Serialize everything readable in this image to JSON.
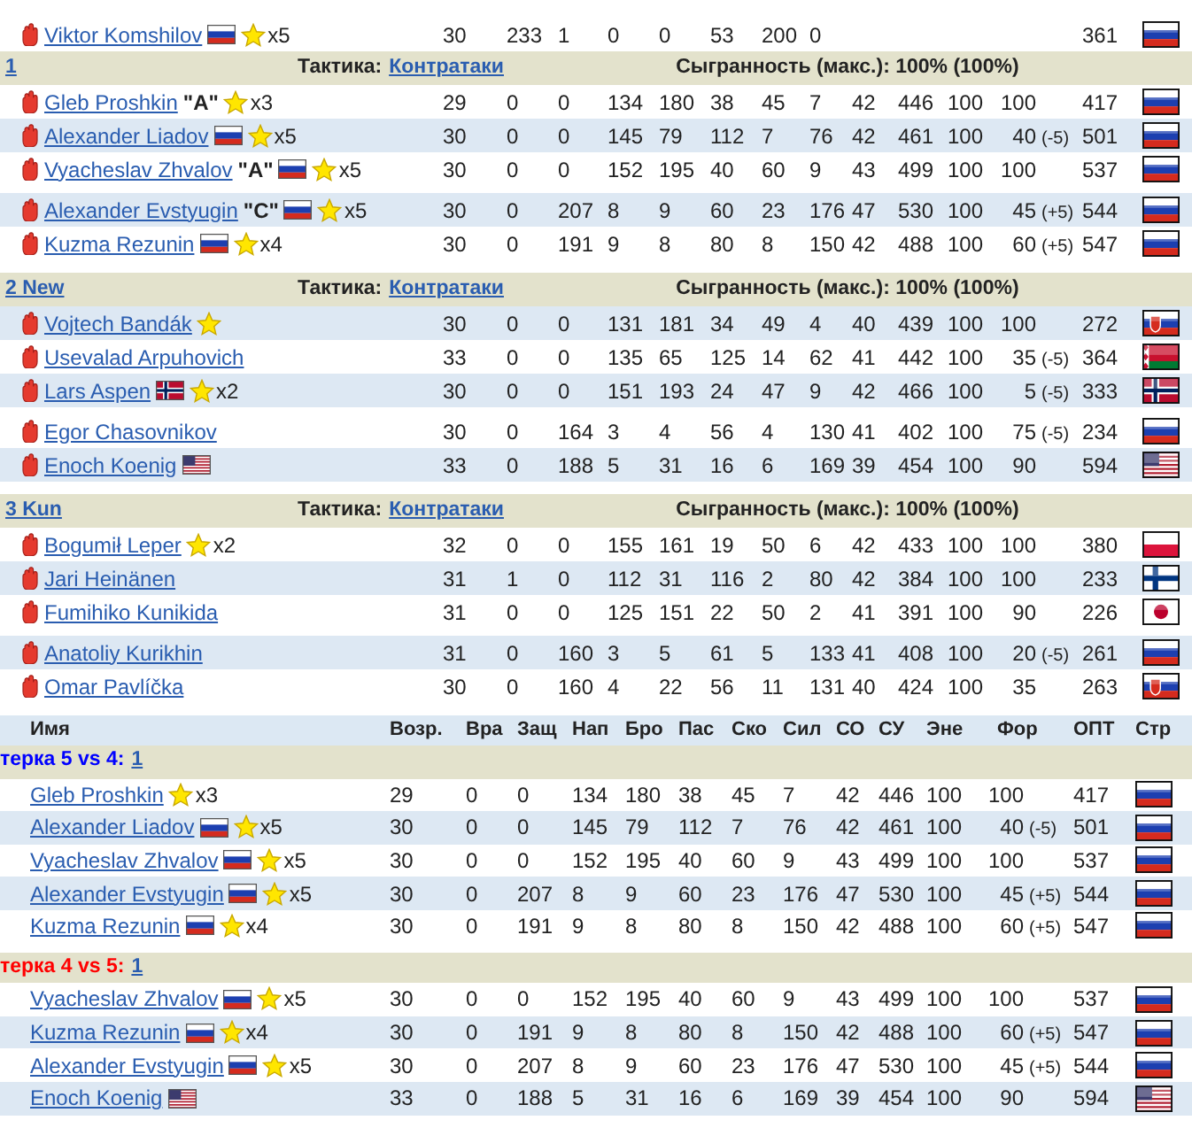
{
  "top_row": {
    "name": "Viktor Komshilov",
    "shaded": false,
    "name_flag": {
      "kind": "russia"
    },
    "star": true,
    "star_count": "x5",
    "stats": [
      "30",
      "233",
      "1",
      "0",
      "0",
      "53",
      "200",
      "0"
    ],
    "opt": "361",
    "flag": {
      "kind": "russia"
    }
  },
  "lines": [
    {
      "label": "1",
      "tactic_label": "Тактика:",
      "tactic": "Контратаки",
      "cohesion": "Сыгранность (макс.): 100% (100%)",
      "players": [
        {
          "name": "Gleb Proshkin",
          "shaded": false,
          "captain": "\"A\"",
          "star": true,
          "star_count": "x3",
          "stats": [
            "29",
            "0",
            "0",
            "134",
            "180",
            "38",
            "45",
            "7",
            "42",
            "446",
            "100"
          ],
          "form": "100",
          "opt": "417",
          "flag": {
            "kind": "russia"
          }
        },
        {
          "name": "Alexander Liadov",
          "shaded": true,
          "name_flag": {
            "kind": "russia"
          },
          "star": true,
          "star_count": "x5",
          "stats": [
            "30",
            "0",
            "0",
            "145",
            "79",
            "112",
            "7",
            "76",
            "42",
            "461",
            "100"
          ],
          "form": "40",
          "form_mod": "(-5)",
          "opt": "501",
          "flag": {
            "kind": "russia"
          }
        },
        {
          "name": "Vyacheslav Zhvalov",
          "shaded": false,
          "captain": "\"A\"",
          "name_flag": {
            "kind": "russia"
          },
          "star": true,
          "star_count": "x5",
          "stats": [
            "30",
            "0",
            "0",
            "152",
            "195",
            "40",
            "60",
            "9",
            "43",
            "499",
            "100"
          ],
          "form": "100",
          "opt": "537",
          "flag": {
            "kind": "russia"
          }
        },
        {
          "name": "Alexander Evstyugin",
          "shaded": true,
          "captain": "\"C\"",
          "name_flag": {
            "kind": "russia"
          },
          "star": true,
          "star_count": "x5",
          "stats": [
            "30",
            "0",
            "207",
            "8",
            "9",
            "60",
            "23",
            "176",
            "47",
            "530",
            "100"
          ],
          "form": "45",
          "form_mod": "(+5)",
          "opt": "544",
          "flag": {
            "kind": "russia"
          }
        },
        {
          "name": "Kuzma Rezunin",
          "shaded": false,
          "name_flag": {
            "kind": "russia"
          },
          "star": true,
          "star_count": "x4",
          "stats": [
            "30",
            "0",
            "191",
            "9",
            "8",
            "80",
            "8",
            "150",
            "42",
            "488",
            "100"
          ],
          "form": "60",
          "form_mod": "(+5)",
          "opt": "547",
          "flag": {
            "kind": "russia"
          }
        }
      ]
    },
    {
      "label": "2 New",
      "tactic_label": "Тактика:",
      "tactic": "Контратаки",
      "cohesion": "Сыгранность (макс.): 100% (100%)",
      "players": [
        {
          "name": "Vojtech Bandák",
          "shaded": true,
          "star": true,
          "stats": [
            "30",
            "0",
            "0",
            "131",
            "181",
            "34",
            "49",
            "4",
            "40",
            "439",
            "100"
          ],
          "form": "100",
          "opt": "272",
          "flag": {
            "kind": "slovakia"
          }
        },
        {
          "name": "Usevalad Arpuhovich",
          "shaded": false,
          "stats": [
            "33",
            "0",
            "0",
            "135",
            "65",
            "125",
            "14",
            "62",
            "41",
            "442",
            "100"
          ],
          "form": "35",
          "form_mod": "(-5)",
          "opt": "364",
          "flag": {
            "kind": "belarus"
          }
        },
        {
          "name": "Lars Aspen",
          "shaded": true,
          "name_flag": {
            "kind": "norway"
          },
          "star": true,
          "star_count": "x2",
          "stats": [
            "30",
            "0",
            "0",
            "151",
            "193",
            "24",
            "47",
            "9",
            "42",
            "466",
            "100"
          ],
          "form": "5",
          "form_mod": "(-5)",
          "opt": "333",
          "flag": {
            "kind": "norway"
          }
        },
        {
          "name": "Egor Chasovnikov",
          "shaded": false,
          "stats": [
            "30",
            "0",
            "164",
            "3",
            "4",
            "56",
            "4",
            "130",
            "41",
            "402",
            "100"
          ],
          "form": "75",
          "form_mod": "(-5)",
          "opt": "234",
          "flag": {
            "kind": "russia"
          }
        },
        {
          "name": "Enoch Koenig",
          "shaded": true,
          "name_flag": {
            "kind": "usa"
          },
          "stats": [
            "33",
            "0",
            "188",
            "5",
            "31",
            "16",
            "6",
            "169",
            "39",
            "454",
            "100"
          ],
          "form": "90",
          "opt": "594",
          "flag": {
            "kind": "usa"
          }
        }
      ]
    },
    {
      "label": "3 Kun",
      "tactic_label": "Тактика:",
      "tactic": "Контратаки",
      "cohesion": "Сыгранность (макс.): 100% (100%)",
      "players": [
        {
          "name": "Bogumił Leper",
          "shaded": false,
          "star": true,
          "star_count": "x2",
          "stats": [
            "32",
            "0",
            "0",
            "155",
            "161",
            "19",
            "50",
            "6",
            "42",
            "433",
            "100"
          ],
          "form": "100",
          "opt": "380",
          "flag": {
            "kind": "poland"
          }
        },
        {
          "name": "Jari Heinänen",
          "shaded": true,
          "stats": [
            "31",
            "1",
            "0",
            "112",
            "31",
            "116",
            "2",
            "80",
            "42",
            "384",
            "100"
          ],
          "form": "100",
          "opt": "233",
          "flag": {
            "kind": "finland"
          }
        },
        {
          "name": "Fumihiko Kunikida",
          "shaded": false,
          "stats": [
            "31",
            "0",
            "0",
            "125",
            "151",
            "22",
            "50",
            "2",
            "41",
            "391",
            "100"
          ],
          "form": "90",
          "opt": "226",
          "flag": {
            "kind": "japan"
          }
        },
        {
          "name": "Anatoliy Kurikhin",
          "shaded": true,
          "stats": [
            "31",
            "0",
            "160",
            "3",
            "5",
            "61",
            "5",
            "133",
            "41",
            "408",
            "100"
          ],
          "form": "20",
          "form_mod": "(-5)",
          "opt": "261",
          "flag": {
            "kind": "russia"
          }
        },
        {
          "name": "Omar Pavlíčka",
          "shaded": false,
          "stats": [
            "30",
            "0",
            "160",
            "4",
            "22",
            "56",
            "11",
            "131",
            "40",
            "424",
            "100"
          ],
          "form": "35",
          "opt": "263",
          "flag": {
            "kind": "slovakia"
          }
        }
      ]
    }
  ],
  "columns": [
    "Имя",
    "Возр.",
    "Вра",
    "Защ",
    "Нап",
    "Бро",
    "Пас",
    "Ско",
    "Сил",
    "СО",
    "СУ",
    "Эне",
    "Фор",
    "ОПТ",
    "Стр"
  ],
  "special_teams": [
    {
      "label": "терка 5 vs 4:",
      "link": "1",
      "color": "#0000ff",
      "players": [
        {
          "name": "Gleb Proshkin",
          "shaded": false,
          "star": true,
          "star_count": "x3",
          "stats": [
            "29",
            "0",
            "0",
            "134",
            "180",
            "38",
            "45",
            "7",
            "42",
            "446",
            "100"
          ],
          "form": "100",
          "opt": "417",
          "flag": {
            "kind": "russia"
          }
        },
        {
          "name": "Alexander Liadov",
          "shaded": true,
          "name_flag": {
            "kind": "russia"
          },
          "star": true,
          "star_count": "x5",
          "stats": [
            "30",
            "0",
            "0",
            "145",
            "79",
            "112",
            "7",
            "76",
            "42",
            "461",
            "100"
          ],
          "form": "40",
          "form_mod": "(-5)",
          "opt": "501",
          "flag": {
            "kind": "russia"
          }
        },
        {
          "name": "Vyacheslav Zhvalov",
          "shaded": false,
          "name_flag": {
            "kind": "russia"
          },
          "star": true,
          "star_count": "x5",
          "stats": [
            "30",
            "0",
            "0",
            "152",
            "195",
            "40",
            "60",
            "9",
            "43",
            "499",
            "100"
          ],
          "form": "100",
          "opt": "537",
          "flag": {
            "kind": "russia"
          }
        },
        {
          "name": "Alexander Evstyugin",
          "shaded": true,
          "name_flag": {
            "kind": "russia"
          },
          "star": true,
          "star_count": "x5",
          "stats": [
            "30",
            "0",
            "207",
            "8",
            "9",
            "60",
            "23",
            "176",
            "47",
            "530",
            "100"
          ],
          "form": "45",
          "form_mod": "(+5)",
          "opt": "544",
          "flag": {
            "kind": "russia"
          }
        },
        {
          "name": "Kuzma Rezunin",
          "shaded": false,
          "name_flag": {
            "kind": "russia"
          },
          "star": true,
          "star_count": "x4",
          "stats": [
            "30",
            "0",
            "191",
            "9",
            "8",
            "80",
            "8",
            "150",
            "42",
            "488",
            "100"
          ],
          "form": "60",
          "form_mod": "(+5)",
          "opt": "547",
          "flag": {
            "kind": "russia"
          }
        }
      ]
    },
    {
      "label": "терка 4 vs 5:",
      "link": "1",
      "color": "#ff0000",
      "players": [
        {
          "name": "Vyacheslav Zhvalov",
          "shaded": false,
          "name_flag": {
            "kind": "russia"
          },
          "star": true,
          "star_count": "x5",
          "stats": [
            "30",
            "0",
            "0",
            "152",
            "195",
            "40",
            "60",
            "9",
            "43",
            "499",
            "100"
          ],
          "form": "100",
          "opt": "537",
          "flag": {
            "kind": "russia"
          }
        },
        {
          "name": "Kuzma Rezunin",
          "shaded": true,
          "name_flag": {
            "kind": "russia"
          },
          "star": true,
          "star_count": "x4",
          "stats": [
            "30",
            "0",
            "191",
            "9",
            "8",
            "80",
            "8",
            "150",
            "42",
            "488",
            "100"
          ],
          "form": "60",
          "form_mod": "(+5)",
          "opt": "547",
          "flag": {
            "kind": "russia"
          }
        },
        {
          "name": "Alexander Evstyugin",
          "shaded": false,
          "name_flag": {
            "kind": "russia"
          },
          "star": true,
          "star_count": "x5",
          "stats": [
            "30",
            "0",
            "207",
            "8",
            "9",
            "60",
            "23",
            "176",
            "47",
            "530",
            "100"
          ],
          "form": "45",
          "form_mod": "(+5)",
          "opt": "544",
          "flag": {
            "kind": "russia"
          }
        },
        {
          "name": "Enoch Koenig",
          "shaded": true,
          "name_flag": {
            "kind": "usa"
          },
          "stats": [
            "33",
            "0",
            "188",
            "5",
            "31",
            "16",
            "6",
            "169",
            "39",
            "454",
            "100"
          ],
          "form": "90",
          "opt": "594",
          "flag": {
            "kind": "usa"
          }
        }
      ]
    }
  ]
}
